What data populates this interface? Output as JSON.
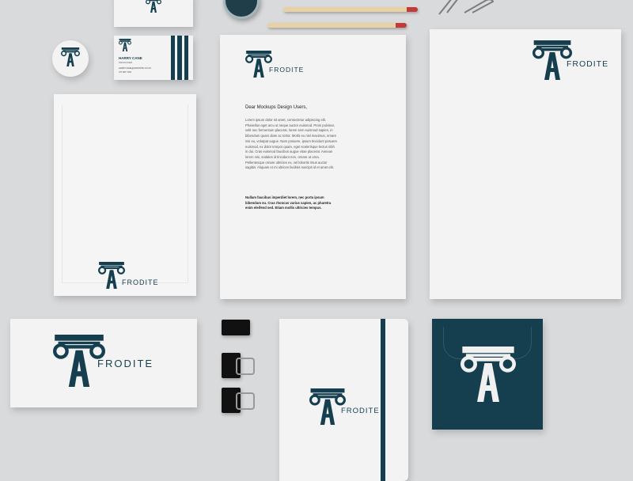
{
  "brand": {
    "wordmark": "FRODITE",
    "logo_letter": "A",
    "color_primary": "#153f4f",
    "color_paper": "#f3f3f3"
  },
  "business_card": {
    "name": "HARRY CANE",
    "title": "PRODUCER",
    "email": "HARRYCANE@AFRODITE.CO.UK",
    "phone": "077 987 7403"
  },
  "letter": {
    "greeting": "Dear Mockups Design Users,",
    "body": "Lorem ipsum dolor sit amet, consectetur adipiscing elit. Phasellus eget arcu ut neque auctor euismod. Proin pulvinar, velit nec fermentum placerat, lorem sem euismod sapien, in bibendum quam diam ac tortor. Morbi eu nisl maximus, ornare nisi eu, volutpat augue. Nam posuere, ipsum tincidunt posuere euismod, ex dolor tempor quam, eget scelerisque lectus nibh in dui. Cras euismod faucibus augue vitae placerat. Aenean lorem nisi, sodales id tincidunt non, ornare ut urna. Pellentesque ornare ultricies ex, vel lobortis risus auctor sagittis. Aliquam et mi ultrices facilisis suscipit id et amet elit.",
    "closing": "Nullam faucibus imperdiet lorem, nec porta ipsum bibendum eu. Cras rhoncus varius sapien, ac pharetra enim eleifend sed. Etiam mollis ultricies tempus."
  }
}
